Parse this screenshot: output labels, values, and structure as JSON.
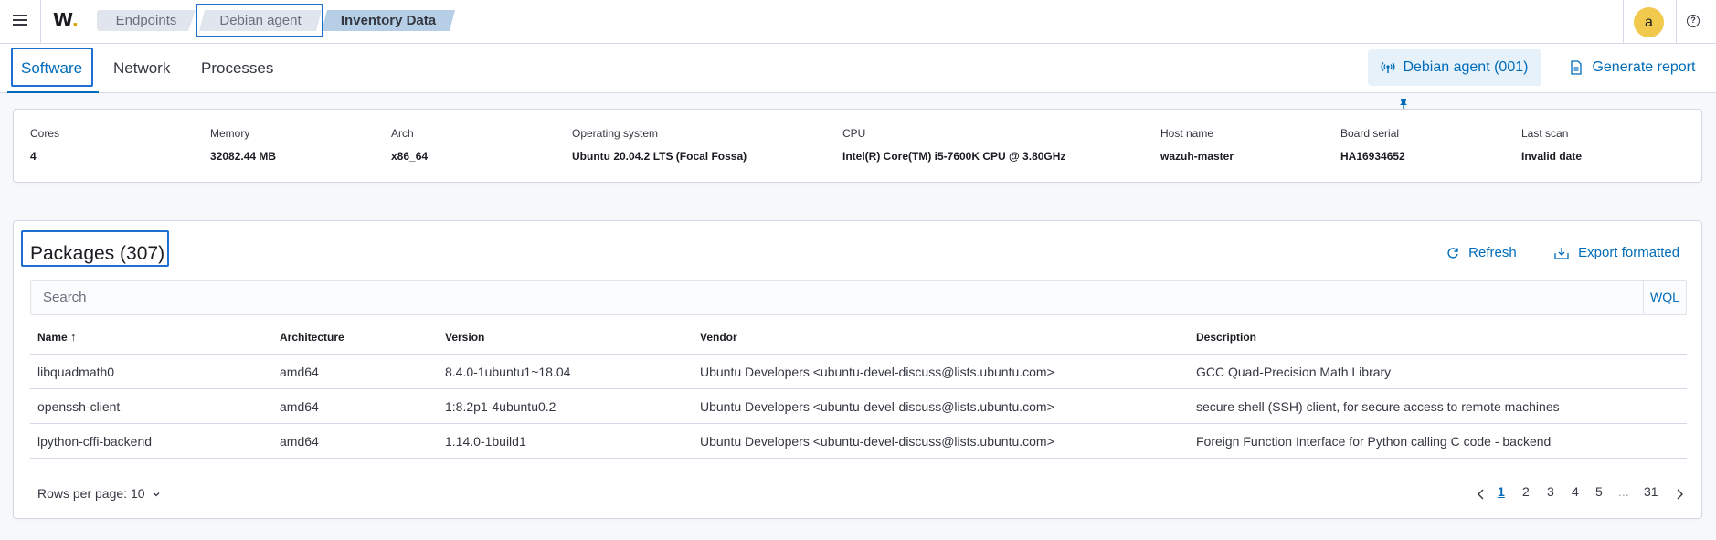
{
  "header": {
    "logo_text": "W",
    "breadcrumbs": [
      "Endpoints",
      "Debian agent",
      "Inventory Data"
    ],
    "avatar_initial": "a",
    "help_glyph": "?"
  },
  "tabs": [
    {
      "label": "Software",
      "active": true
    },
    {
      "label": "Network",
      "active": false
    },
    {
      "label": "Processes",
      "active": false
    }
  ],
  "agent_button": {
    "label": "Debian agent (001)"
  },
  "generate_report": {
    "label": "Generate report"
  },
  "agent_info": [
    {
      "label": "Cores",
      "value": "4"
    },
    {
      "label": "Memory",
      "value": "32082.44 MB"
    },
    {
      "label": "Arch",
      "value": "x86_64"
    },
    {
      "label": "Operating system",
      "value": "Ubuntu 20.04.2 LTS (Focal Fossa)"
    },
    {
      "label": "CPU",
      "value": "Intel(R) Core(TM) i5-7600K CPU @ 3.80GHz"
    },
    {
      "label": "Host name",
      "value": "wazuh-master"
    },
    {
      "label": "Board serial",
      "value": "HA16934652"
    },
    {
      "label": "Last scan",
      "value": "Invalid date"
    }
  ],
  "packages": {
    "title": "Packages (307)",
    "refresh_label": "Refresh",
    "export_label": "Export formatted",
    "search_placeholder": "Search",
    "wql_label": "WQL",
    "columns": [
      "Name",
      "Architecture",
      "Version",
      "Vendor",
      "Description"
    ],
    "sort_glyph": "↑",
    "rows": [
      [
        "libquadmath0",
        "amd64",
        "8.4.0-1ubuntu1~18.04",
        "Ubuntu Developers <ubuntu-devel-discuss@lists.ubuntu.com>",
        "GCC Quad-Precision Math Library"
      ],
      [
        "openssh-client",
        "amd64",
        "1:8.2p1-4ubuntu0.2",
        "Ubuntu Developers <ubuntu-devel-discuss@lists.ubuntu.com>",
        "secure shell (SSH) client, for secure access to remote machines"
      ],
      [
        "lpython-cffi-backend",
        "amd64",
        "1.14.0-1build1",
        "Ubuntu Developers <ubuntu-devel-discuss@lists.ubuntu.com>",
        "Foreign Function Interface for Python calling C code - backend"
      ]
    ],
    "rows_per_page": "Rows per page: 10",
    "pagination": [
      "1",
      "2",
      "3",
      "4",
      "5",
      "...",
      "31"
    ],
    "current_page": "1"
  },
  "colors": {
    "accent": "#006bb8",
    "highlight": "#1c6fd1",
    "avatar": "#f0c94d"
  }
}
